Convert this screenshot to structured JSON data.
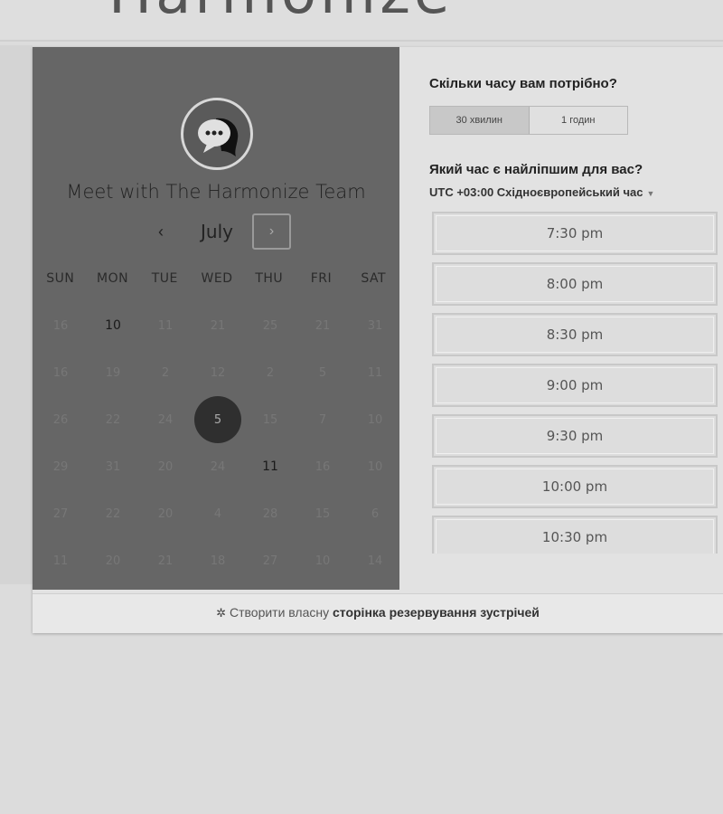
{
  "brand": {
    "logo_text": "Harmonize"
  },
  "profile": {
    "title": "Meet with The Harmonize Team"
  },
  "calendar": {
    "prev_label": "‹",
    "month": "July",
    "next_label": "›",
    "weekdays": [
      "SUN",
      "MON",
      "TUE",
      "WED",
      "THU",
      "FRI",
      "SAT"
    ],
    "weeks": [
      [
        "16",
        "10",
        "11",
        "21",
        "25",
        "21",
        "31"
      ],
      [
        "16",
        "19",
        "2",
        "12",
        "2",
        "5",
        "11"
      ],
      [
        "26",
        "22",
        "24",
        "5",
        "15",
        "7",
        "10"
      ],
      [
        "29",
        "31",
        "20",
        "24",
        "11",
        "16",
        "10"
      ],
      [
        "27",
        "22",
        "20",
        "4",
        "28",
        "15",
        "6"
      ],
      [
        "11",
        "20",
        "21",
        "18",
        "27",
        "10",
        "14"
      ]
    ],
    "active_days": [
      "0-1",
      "3-4"
    ],
    "selected_day": "2-3"
  },
  "duration": {
    "question": "Скільки часу вам потрібно?",
    "options": [
      "30 хвилин",
      "1 годин"
    ],
    "selected": 0
  },
  "time": {
    "question": "Який час є найліпшим для вас?",
    "timezone": "UTC +03:00 Східноєвропейський час",
    "slots": [
      "7:30 pm",
      "8:00 pm",
      "8:30 pm",
      "9:00 pm",
      "9:30 pm",
      "10:00 pm",
      "10:30 pm"
    ]
  },
  "footer": {
    "prefix": "Створити власну",
    "link": "сторінка резервування зустрічей"
  }
}
